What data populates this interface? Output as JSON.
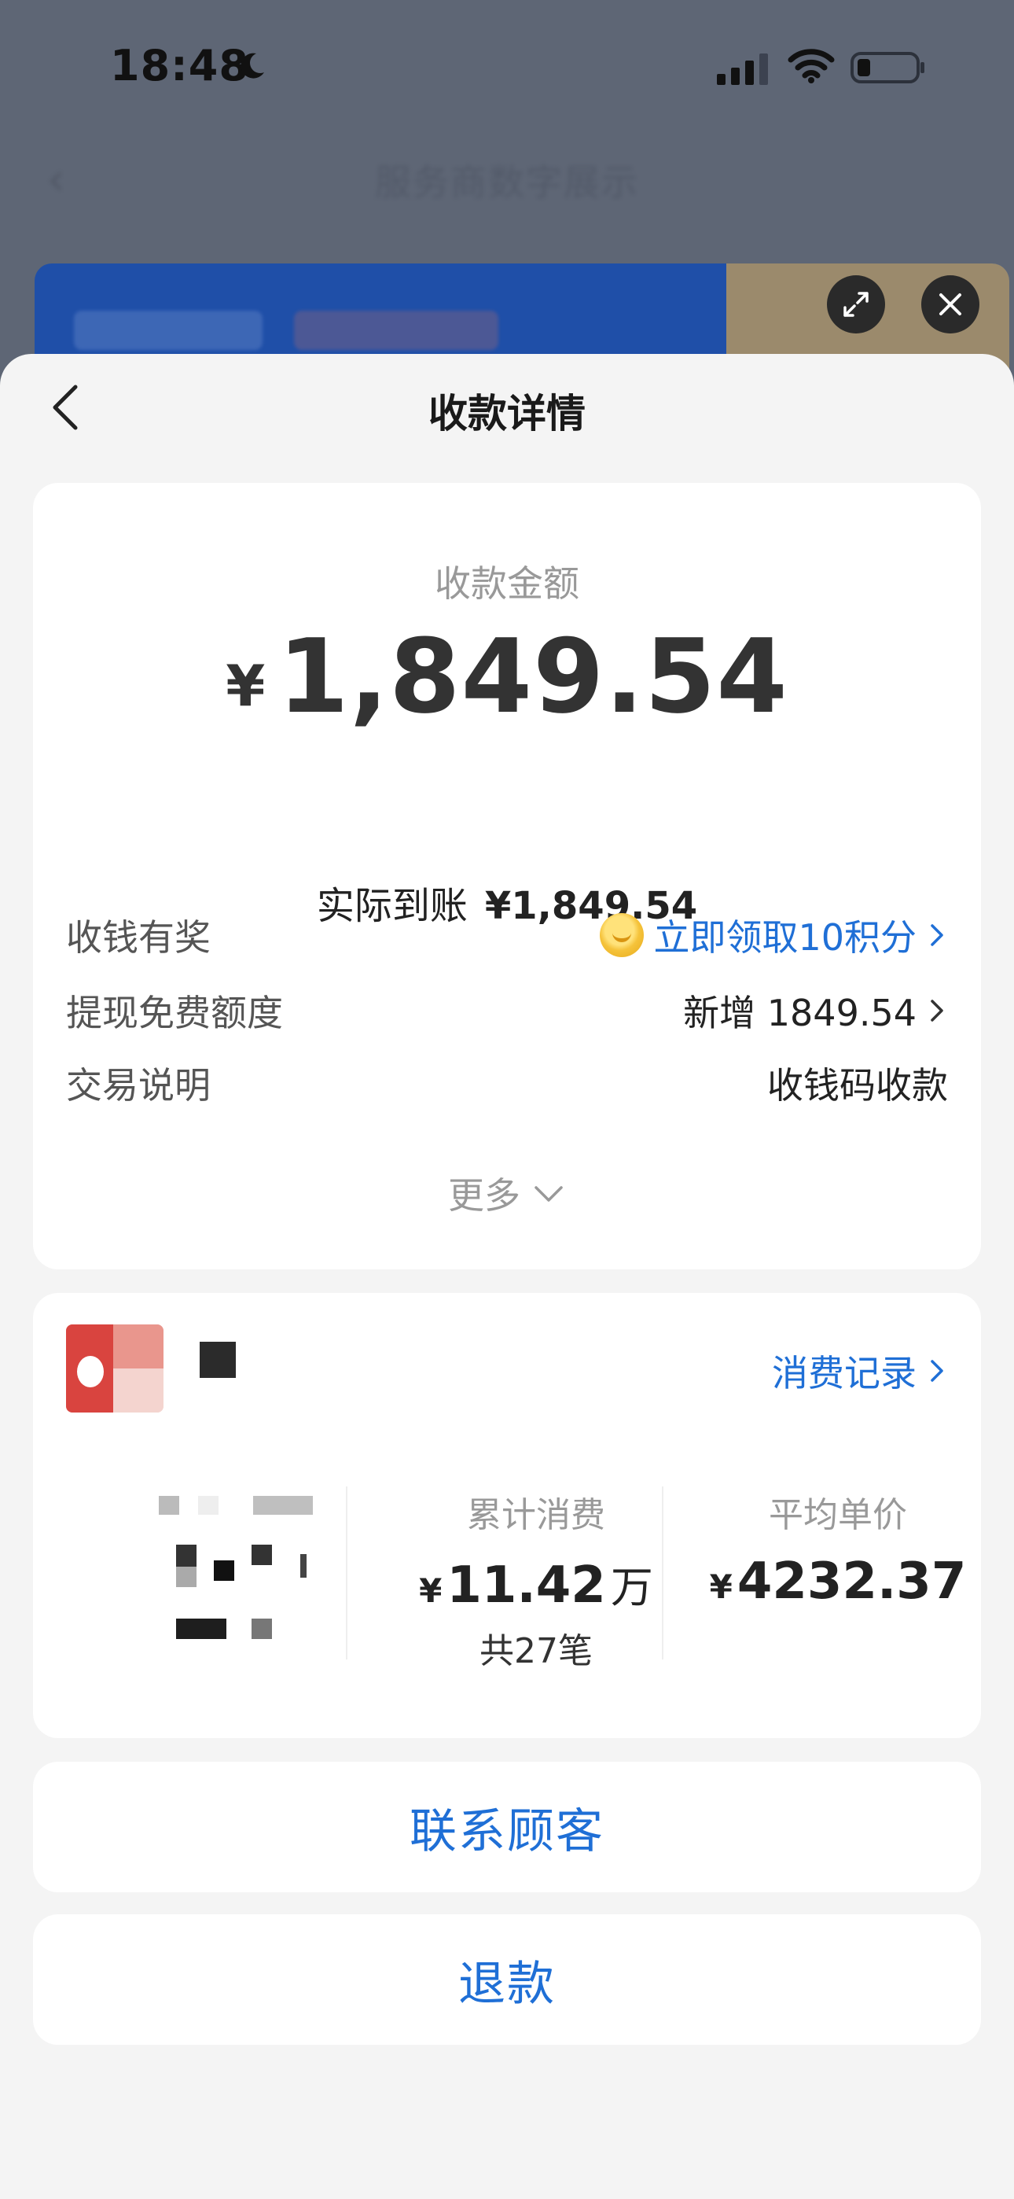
{
  "status_bar": {
    "time": "18:48",
    "moon_icon": "moon-icon",
    "signal_icon": "cellular-signal-icon",
    "wifi_icon": "wifi-icon",
    "battery_icon": "battery-low-icon"
  },
  "backdrop": {
    "nav_title": "服务商数字展示",
    "back_icon": "chevron-left-icon",
    "expand_icon": "expand-icon",
    "close_icon": "close-icon"
  },
  "sheet": {
    "title": "收款详情",
    "back_icon": "chevron-left-icon"
  },
  "amount_card": {
    "label": "收款金额",
    "currency": "¥",
    "amount": "1,849.54",
    "actual_label": "实际到账",
    "actual_value": "¥1,849.54",
    "rows": [
      {
        "key": "收钱有奖",
        "value": "立即领取10积分",
        "icon": "coin-icon"
      },
      {
        "key": "提现免费额度",
        "value": "新增 1849.54"
      },
      {
        "key": "交易说明",
        "value": "收钱码收款"
      }
    ],
    "more_label": "更多"
  },
  "customer_card": {
    "history_link": "消费记录",
    "total_label": "累计消费",
    "total_currency": "¥",
    "total_value": "11.42",
    "total_unit": "万",
    "total_count": "共27笔",
    "avg_label": "平均单价",
    "avg_currency": "¥",
    "avg_value": "4232.37"
  },
  "actions": {
    "contact": "联系顾客",
    "refund": "退款"
  },
  "colors": {
    "accent_blue": "#1f6fd6",
    "sheet_bg": "#f4f4f4",
    "card_bg": "#ffffff",
    "backdrop": "#5e6675"
  }
}
